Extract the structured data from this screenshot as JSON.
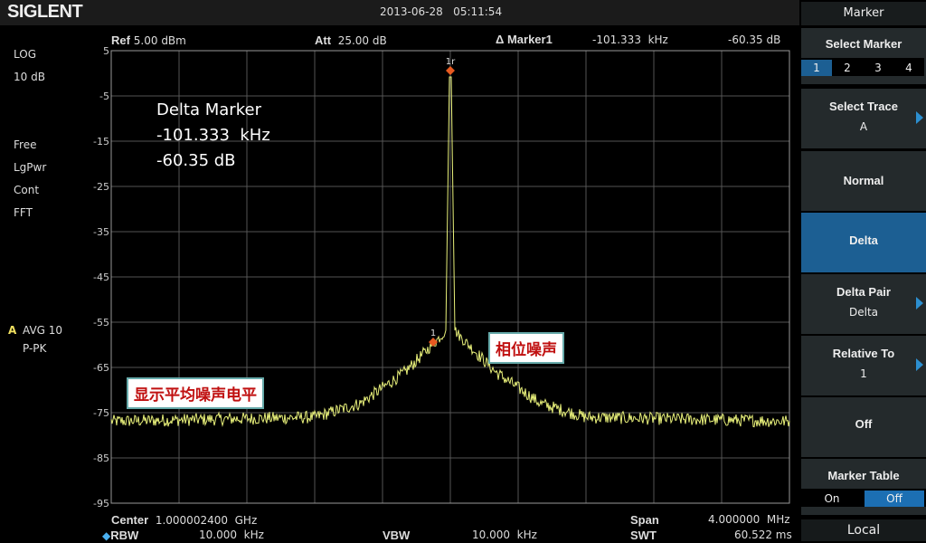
{
  "header": {
    "logo": "SIGLENT",
    "datetime": "2013-06-28   05:11:54"
  },
  "left_panel": {
    "scale_type": "LOG",
    "scale_div": "10 dB",
    "trigger": "Free",
    "detector": "LgPwr",
    "sweep_mode": "Cont",
    "sweep_type": "FFT",
    "trace_label": "A",
    "trace_mode": "AVG 10",
    "trace_detector": "P-PK"
  },
  "top_info": {
    "ref_label": "Ref",
    "ref_value": "5.00 dBm",
    "att_label": "Att",
    "att_value": "25.00 dB",
    "marker_label": "Δ Marker1",
    "marker_freq": "-101.333  kHz",
    "marker_level": "-60.35 dB"
  },
  "overlay": {
    "title": "Delta Marker",
    "freq": "-101.333  kHz",
    "level": "-60.35 dB"
  },
  "annotations": {
    "floor": "显示平均噪声电平",
    "phase_noise": "相位噪声"
  },
  "markers": {
    "ref_label": "1r",
    "m1_label": "1"
  },
  "bottom_info": {
    "center_label": "Center",
    "center_value": "1.000002400  GHz",
    "span_label": "Span",
    "span_value": "4.000000  MHz",
    "rbw_label": "RBW",
    "rbw_value": "10.000  kHz",
    "vbw_label": "VBW",
    "vbw_value": "10.000  kHz",
    "swt_label": "SWT",
    "swt_value": "60.522 ms"
  },
  "softkeys": {
    "title": "Marker",
    "select_marker": "Select Marker",
    "marker_nums": [
      "1",
      "2",
      "3",
      "4"
    ],
    "selected_marker": "1",
    "select_trace": "Select Trace",
    "select_trace_value": "A",
    "normal": "Normal",
    "delta": "Delta",
    "delta_pair": "Delta Pair",
    "delta_pair_value": "Delta",
    "relative_to": "Relative To",
    "relative_to_value": "1",
    "off": "Off",
    "marker_table": "Marker Table",
    "table_on": "On",
    "table_off": "Off",
    "local": "Local"
  },
  "chart_data": {
    "type": "line",
    "ylabel": "dBm",
    "ylim": [
      -95,
      5
    ],
    "yticks": [
      "5",
      "-5",
      "-15",
      "-25",
      "-35",
      "-45",
      "-55",
      "-65",
      "-75",
      "-85",
      "-95"
    ],
    "x_center_ghz": 1.0000024,
    "span_mhz": 4,
    "divisions": 10,
    "peak_dbm": -0.8,
    "noise_floor_dbm": -77,
    "marker1_offset_khz": -101.333,
    "marker1_level_dbm": -59.4,
    "trace_color": "#e8f07a",
    "marker_color": "#e85a20"
  }
}
